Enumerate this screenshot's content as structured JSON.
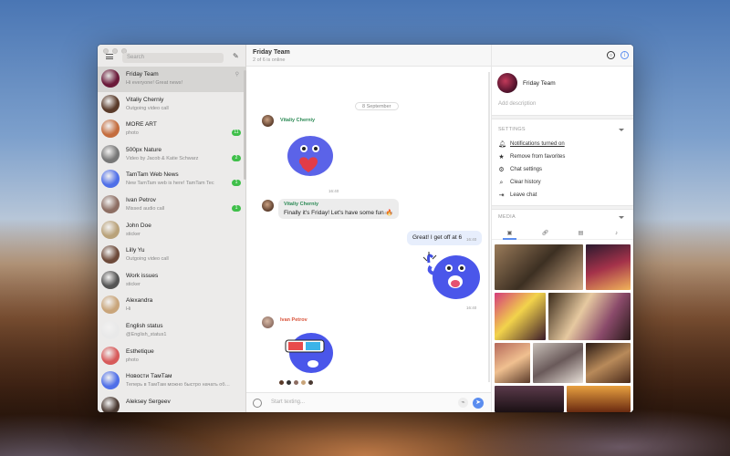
{
  "sidebar": {
    "search_placeholder": "Search",
    "chats": [
      {
        "name": "Friday Team",
        "preview": "Hi everyone! Great news!",
        "badge": "",
        "pinned": true,
        "avatar_color": "#6b1a3a"
      },
      {
        "name": "Vitaliy Cherniy",
        "preview": "Outgoing video call",
        "badge": "",
        "avatar_color": "#5a3b2a"
      },
      {
        "name": "MORE ART",
        "preview": "photo",
        "badge": "11",
        "avatar_color": "#c46d3e"
      },
      {
        "name": "500px Nature",
        "preview": "Video by Jacob & Katie Schwarz",
        "badge": "2",
        "avatar_color": "#777777"
      },
      {
        "name": "TamTam Web News",
        "preview": "New TamTam web is here! TamTam Tec",
        "badge": "1",
        "avatar_color": "#4f6fe8"
      },
      {
        "name": "Ivan Petrov",
        "preview": "Missed audio call",
        "badge": "1",
        "avatar_color": "#8d6e63"
      },
      {
        "name": "John Doe",
        "preview": "sticker",
        "badge": "",
        "avatar_color": "#b9a27a"
      },
      {
        "name": "Lilly Yu",
        "preview": "Outgoing video call",
        "badge": "",
        "avatar_color": "#6d4a3a"
      },
      {
        "name": "Work issues",
        "preview": "sticker",
        "badge": "",
        "avatar_color": "#555555"
      },
      {
        "name": "Alexandra",
        "preview": "Hi",
        "badge": "",
        "avatar_color": "#c9a57a"
      },
      {
        "name": "English status",
        "preview": "@English_status1",
        "badge": "",
        "avatar_color": "#e9e9e9"
      },
      {
        "name": "Esthetique",
        "preview": "photo",
        "badge": "",
        "avatar_color": "#d75a5a"
      },
      {
        "name": "Новости ТамТам",
        "preview": "Теперь в ТамТам можно быстро начать общать",
        "badge": "",
        "avatar_color": "#4f6fe8"
      },
      {
        "name": "Aleksey Sergeev",
        "preview": "",
        "badge": "",
        "avatar_color": "#4a3a32"
      }
    ]
  },
  "chat": {
    "title": "Friday Team",
    "subtitle": "2 of 6 is online",
    "date_separator": "8 September",
    "messages": [
      {
        "sender": "Vitaliy Cherniy",
        "kind": "sticker",
        "time": "16:40"
      },
      {
        "sender": "Vitaliy Cherniy",
        "text": "Finally it's Friday! Let's have some fun",
        "time": "16:40"
      },
      {
        "sender": "me",
        "text": "Great! I get off at 6",
        "time": "16:40"
      },
      {
        "sender": "me",
        "kind": "sticker",
        "time": "16:40"
      },
      {
        "sender": "Ivan Petrov",
        "kind": "sticker",
        "time": ""
      }
    ],
    "input_placeholder": "Start texting...",
    "emoji_icon": "smile-icon",
    "attach_icon": "paperclip-icon",
    "send_icon": "paper-plane-icon"
  },
  "info": {
    "group_name": "Friday Team",
    "add_description": "Add description",
    "settings_label": "SETTINGS",
    "settings": [
      {
        "icon": "bell-icon",
        "label": "Notifications turned on"
      },
      {
        "icon": "star-icon",
        "label": "Remove from favorites"
      },
      {
        "icon": "gear-icon",
        "label": "Chat settings"
      },
      {
        "icon": "broom-icon",
        "label": "Clear history"
      },
      {
        "icon": "exit-icon",
        "label": "Leave chat"
      }
    ],
    "media_label": "MEDIA",
    "media_tabs": [
      "photo-tab-icon",
      "link-tab-icon",
      "file-tab-icon",
      "audio-tab-icon"
    ]
  },
  "colors": {
    "accent": "#5b8def",
    "green_name": "#2e8b57",
    "red_name": "#d9533a",
    "badge": "#3fbf4a",
    "bubble_in": "#ececec",
    "bubble_out": "#e7eefc"
  }
}
